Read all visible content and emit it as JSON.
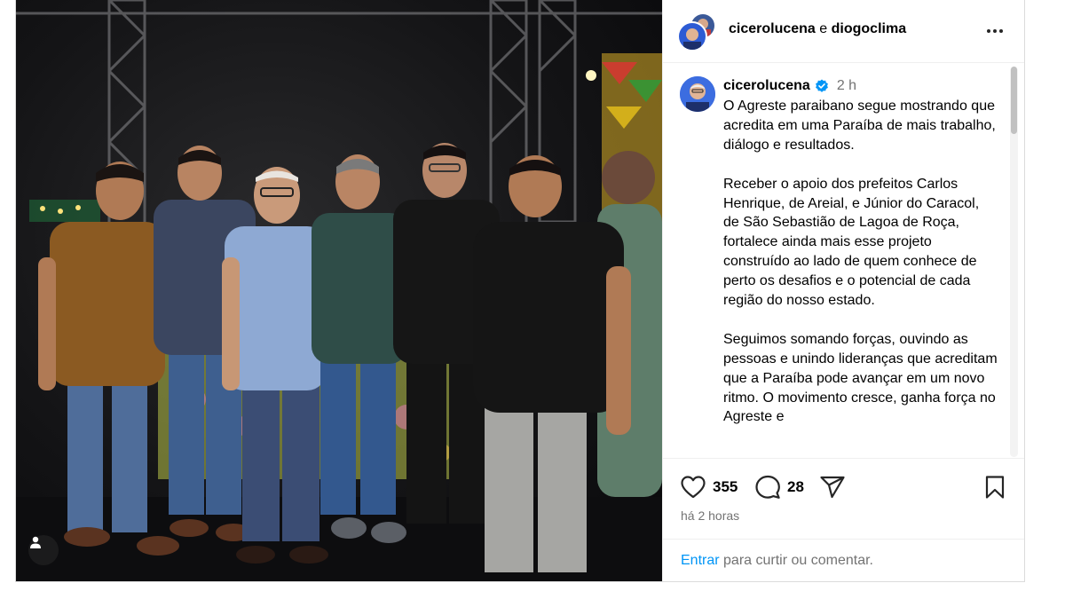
{
  "header": {
    "user1": "cicerolucena",
    "conjunction": "e",
    "user2": "diogoclima"
  },
  "caption": {
    "username": "cicerolucena",
    "time": "2 h",
    "paragraphs": [
      "O Agreste paraibano segue mostrando que acredita em uma Paraíba de mais trabalho, diálogo e resultados.",
      "Receber o apoio dos prefeitos Carlos Henrique, de Areial, e Júnior do Caracol, de São Sebastião de Lagoa de Roça, fortalece ainda mais esse projeto construído ao lado de quem conhece de perto os desafios e o potencial de cada região do nosso estado.",
      "Seguimos somando forças, ouvindo as pessoas e unindo lideranças que acreditam que a Paraíba pode avançar em um novo ritmo. O movimento cresce, ganha força no Agreste e"
    ]
  },
  "actions": {
    "likes": "355",
    "comments": "28",
    "time_ago": "há 2 horas"
  },
  "login": {
    "link": "Entrar",
    "rest": " para curtir ou comentar."
  },
  "icons": {
    "verified": "verified-badge-icon",
    "like": "heart-icon",
    "comment": "comment-bubble-icon",
    "share": "paper-plane-icon",
    "save": "bookmark-icon",
    "more": "more-horizontal-icon",
    "tag": "user-tag-icon"
  },
  "colors": {
    "link_blue": "#0095f6",
    "verified_blue": "#0095f6",
    "muted_text": "#737373"
  }
}
